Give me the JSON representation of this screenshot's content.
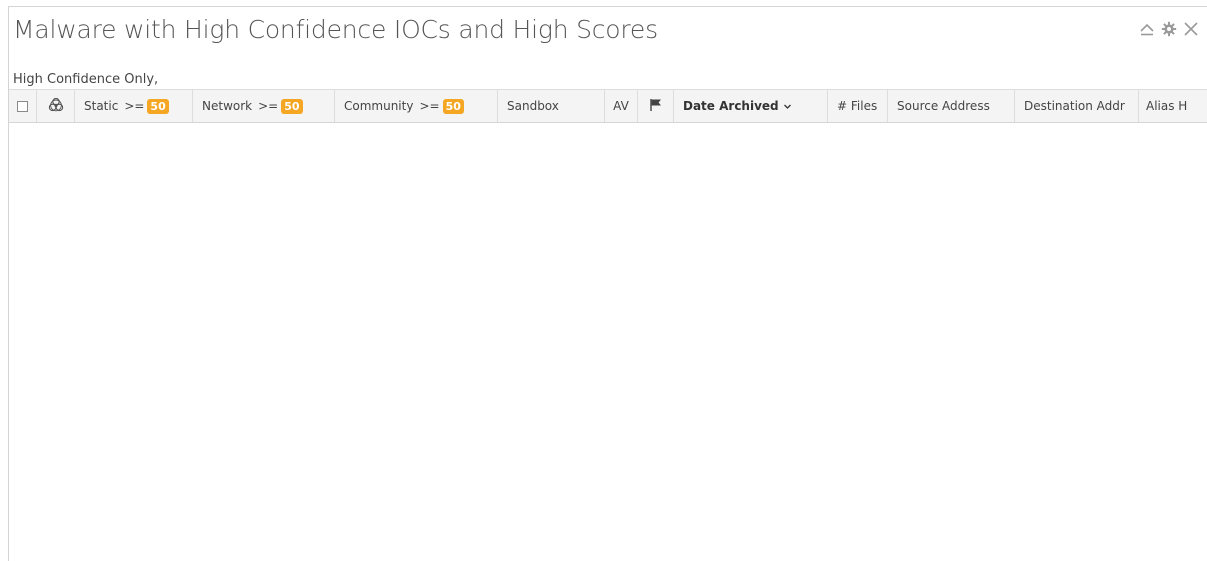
{
  "widget": {
    "title": "Malware with High Confidence IOCs and High Scores",
    "controls": {
      "collapse_icon": "collapse-icon",
      "settings_icon": "gear-icon",
      "close_icon": "close-icon"
    },
    "filter_text": "High Confidence Only,"
  },
  "table": {
    "columns": [
      {
        "key": "select",
        "label": "",
        "icon": "checkbox"
      },
      {
        "key": "threat",
        "label": "",
        "icon": "biohazard-icon"
      },
      {
        "key": "static",
        "label": "Static",
        "operator": ">=",
        "badge": "50"
      },
      {
        "key": "network",
        "label": "Network",
        "operator": ">=",
        "badge": "50"
      },
      {
        "key": "community",
        "label": "Community",
        "operator": ">=",
        "badge": "50"
      },
      {
        "key": "sandbox",
        "label": "Sandbox"
      },
      {
        "key": "av",
        "label": "AV"
      },
      {
        "key": "flag",
        "label": "",
        "icon": "flag-icon"
      },
      {
        "key": "date_archived",
        "label": "Date Archived",
        "sorted": "descending",
        "sort_icon": "chevron-down-icon"
      },
      {
        "key": "files",
        "label": "# Files"
      },
      {
        "key": "source_address",
        "label": "Source Address"
      },
      {
        "key": "destination_address",
        "label": "Destination Addr"
      },
      {
        "key": "alias",
        "label": "Alias H"
      }
    ],
    "rows": []
  },
  "colors": {
    "badge": "#f5a623",
    "header_bg": "#f4f4f4",
    "title_text": "#555555"
  }
}
